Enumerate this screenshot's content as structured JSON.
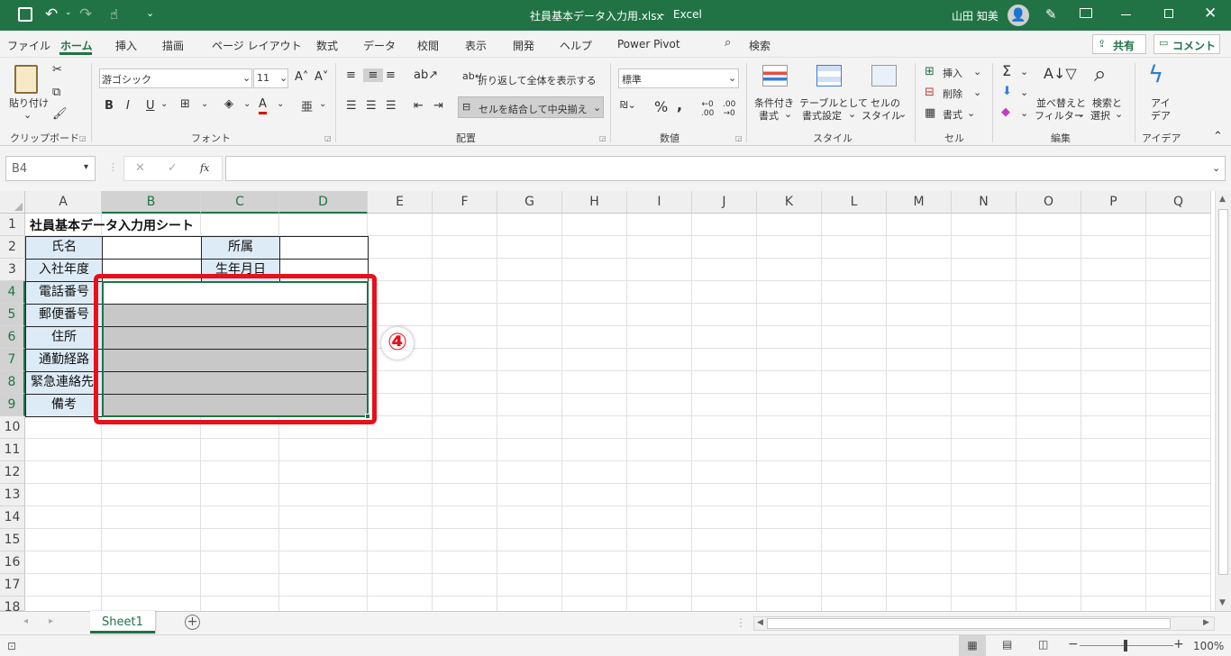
{
  "titlebar": {
    "filename": "社員基本データ入力用.xlsx",
    "sep": "-",
    "app": "Excel",
    "user": "山田 知美"
  },
  "menu": {
    "tabs": [
      "ファイル",
      "ホーム",
      "挿入",
      "描画",
      "ページ レイアウト",
      "数式",
      "データ",
      "校閲",
      "表示",
      "開発",
      "ヘルプ",
      "Power Pivot"
    ],
    "search": "検索",
    "share": "共有",
    "comment": "コメント"
  },
  "ribbon": {
    "clipboard": {
      "paste": "貼り付け",
      "label": "クリップボード"
    },
    "font": {
      "name": "游ゴシック",
      "size": "11",
      "bold": "B",
      "italic": "I",
      "underline": "U",
      "label": "フォント"
    },
    "alignment": {
      "wrap": "折り返して全体を表示する",
      "merge": "セルを結合して中央揃え",
      "label": "配置"
    },
    "number": {
      "format": "標準",
      "label": "数値"
    },
    "styles": {
      "conditional": "条件付き",
      "conditional2": "書式",
      "table": "テーブルとして",
      "table2": "書式設定",
      "cell": "セルの",
      "cell2": "スタイル",
      "label": "スタイル"
    },
    "cells": {
      "insert": "挿入",
      "delete": "削除",
      "format": "書式",
      "label": "セル"
    },
    "editing": {
      "sort": "並べ替えと",
      "sort2": "フィルター",
      "find": "検索と",
      "find2": "選択",
      "label": "編集"
    },
    "ideas": {
      "label1": "アイ",
      "label2": "デア",
      "group": "アイデア"
    }
  },
  "formula_bar": {
    "name_box": "B4",
    "fx": "fx",
    "value": ""
  },
  "columns": [
    "A",
    "B",
    "C",
    "D",
    "E",
    "F",
    "G",
    "H",
    "I",
    "J",
    "K",
    "L",
    "M",
    "N",
    "O",
    "P",
    "Q"
  ],
  "rows": [
    "1",
    "2",
    "3",
    "4",
    "5",
    "6",
    "7",
    "8",
    "9",
    "10",
    "11",
    "12",
    "13",
    "14",
    "15",
    "16",
    "17",
    "18"
  ],
  "sheet": {
    "title": "社員基本データ入力用シート",
    "labels": {
      "name": "氏名",
      "affiliation": "所属",
      "join_year": "入社年度",
      "birthday": "生年月日",
      "phone": "電話番号",
      "postal": "郵便番号",
      "address": "住所",
      "commute": "通勤経路",
      "emergency": "緊急連絡先",
      "notes": "備考"
    }
  },
  "annotation": {
    "step": "④",
    "color": "#e8101b"
  },
  "sheet_tabs": {
    "active": "Sheet1"
  },
  "status": {
    "zoom": "100%"
  },
  "colors": {
    "excel_green": "#217346",
    "label_fill": "#ddebf7",
    "selection_grey": "#c8c8c8"
  }
}
